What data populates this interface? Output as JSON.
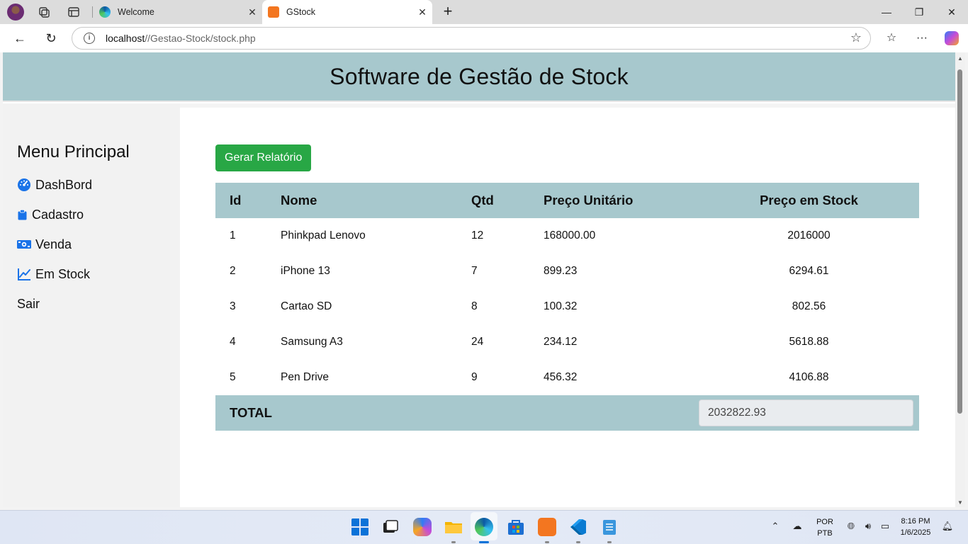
{
  "browser": {
    "tabs": [
      {
        "title": "Welcome",
        "active": false
      },
      {
        "title": "GStock",
        "active": true
      }
    ],
    "url_host": "localhost",
    "url_path": "//Gestao-Stock/stock.php"
  },
  "header": {
    "title": "Software de Gestão de Stock"
  },
  "sidebar": {
    "title": "Menu Principal",
    "items": [
      {
        "label": "DashBord",
        "icon": "gauge-icon"
      },
      {
        "label": "Cadastro",
        "icon": "clipboard-icon"
      },
      {
        "label": "Venda",
        "icon": "money-bill-icon"
      },
      {
        "label": "Em Stock",
        "icon": "line-chart-icon"
      },
      {
        "label": "Sair",
        "icon": ""
      }
    ]
  },
  "main": {
    "report_button": "Gerar Relatório",
    "table": {
      "headers": [
        "Id",
        "Nome",
        "Qtd",
        "Preço Unitário",
        "Preço em Stock"
      ],
      "rows": [
        [
          "1",
          "Phinkpad Lenovo",
          "12",
          "168000.00",
          "2016000"
        ],
        [
          "2",
          "iPhone 13",
          "7",
          "899.23",
          "6294.61"
        ],
        [
          "3",
          "Cartao SD",
          "8",
          "100.32",
          "802.56"
        ],
        [
          "4",
          "Samsung A3",
          "24",
          "234.12",
          "5618.88"
        ],
        [
          "5",
          "Pen Drive",
          "9",
          "456.32",
          "4106.88"
        ]
      ],
      "total_label": "TOTAL",
      "total_value": "2032822.93"
    }
  },
  "taskbar": {
    "lang_top": "POR",
    "lang_bottom": "PTB",
    "time": "8:16 PM",
    "date": "1/6/2025"
  },
  "colors": {
    "header_bg": "#a7c8cd",
    "button_green": "#28a745",
    "icon_blue": "#1a73e8"
  }
}
